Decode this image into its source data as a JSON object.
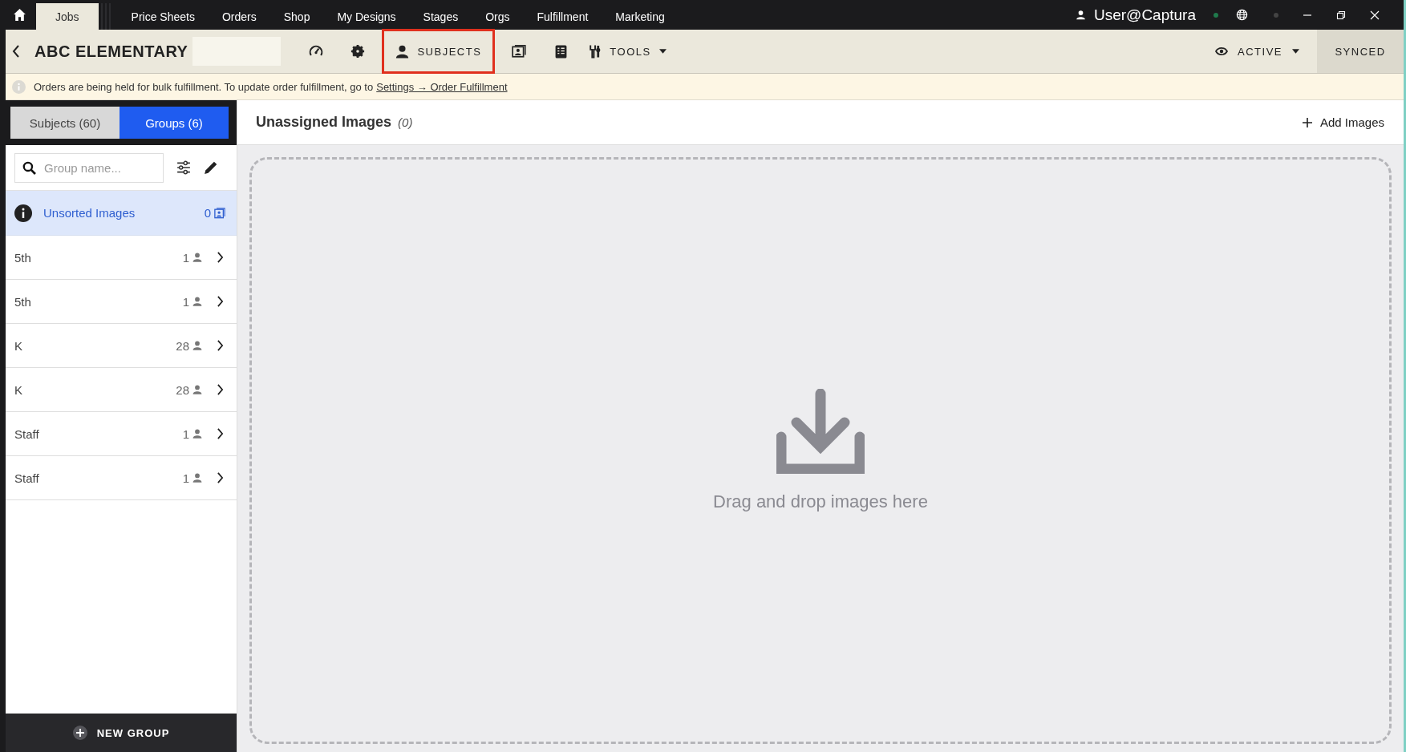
{
  "nav": {
    "items": [
      {
        "label": "Jobs",
        "selected": true
      },
      {
        "label": "Price Sheets",
        "selected": false
      },
      {
        "label": "Orders",
        "selected": false
      },
      {
        "label": "Shop",
        "selected": false
      },
      {
        "label": "My Designs",
        "selected": false
      },
      {
        "label": "Stages",
        "selected": false
      },
      {
        "label": "Orgs",
        "selected": false
      },
      {
        "label": "Fulfillment",
        "selected": false
      },
      {
        "label": "Marketing",
        "selected": false
      }
    ],
    "user": "User@Captura"
  },
  "toolbar": {
    "title": "ABC ELEMENTARY",
    "items": [
      {
        "kind": "gauge",
        "selected": false
      },
      {
        "kind": "gear",
        "selected": false
      },
      {
        "kind": "subjects",
        "label": "SUBJECTS",
        "selected": true
      },
      {
        "kind": "photo",
        "selected": false
      },
      {
        "kind": "sheet",
        "selected": false
      },
      {
        "kind": "tools",
        "label": "TOOLS",
        "selected": false
      }
    ],
    "status": "ACTIVE",
    "sync": "SYNCED"
  },
  "notice": {
    "text": "Orders are being held for bulk fulfillment. To update order fulfillment, go to",
    "link": "Settings → Order Fulfillment"
  },
  "sidebar": {
    "tabs": [
      {
        "label": "Subjects (60)",
        "selected": false
      },
      {
        "label": "Groups (6)",
        "selected": true
      }
    ],
    "search": {
      "placeholder": "Group name..."
    },
    "unsorted": {
      "label": "Unsorted Images",
      "count": "0",
      "selected": true
    },
    "groups": [
      {
        "name": "5th",
        "count": "1"
      },
      {
        "name": "5th",
        "count": "1"
      },
      {
        "name": "K",
        "count": "28"
      },
      {
        "name": "K",
        "count": "28"
      },
      {
        "name": "Staff",
        "count": "1"
      },
      {
        "name": "Staff",
        "count": "1"
      }
    ],
    "new_group": "NEW GROUP"
  },
  "main": {
    "title": "Unassigned Images",
    "count": "(0)",
    "add": "Add Images",
    "drop": "Drag and drop images here"
  }
}
